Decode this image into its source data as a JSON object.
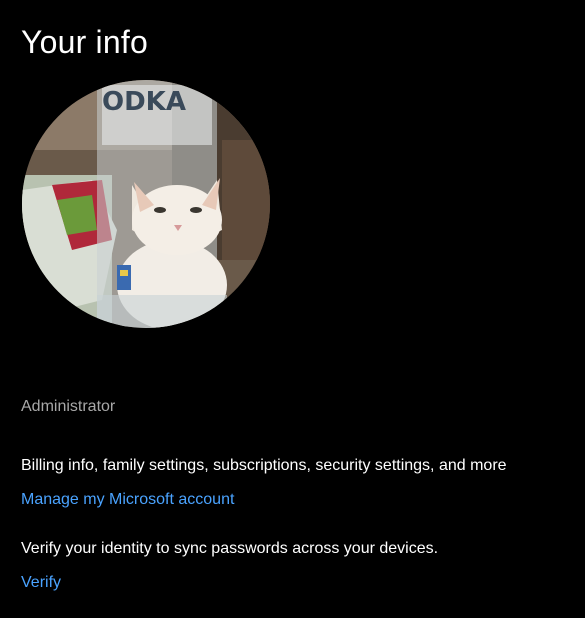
{
  "page": {
    "title": "Your info"
  },
  "account": {
    "role": "Administrator"
  },
  "microsoft_account": {
    "description": "Billing info, family settings, subscriptions, security settings, and more",
    "link_label": "Manage my Microsoft account"
  },
  "identity": {
    "description": "Verify your identity to sync passwords across your devices.",
    "link_label": "Verify"
  },
  "colors": {
    "background": "#000000",
    "text": "#ffffff",
    "secondary_text": "#a8a8a8",
    "accent_link": "#4aa3ff"
  },
  "avatar": {
    "lettering": "ODKA"
  }
}
